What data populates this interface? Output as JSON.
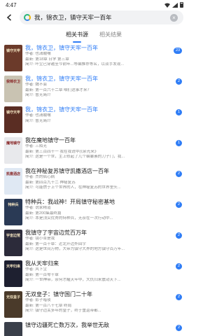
{
  "status": {
    "time": "4:47"
  },
  "search": {
    "query": "我，锦衣卫，镇守天牢一百年"
  },
  "tabs": [
    {
      "label": "相关书源"
    },
    {
      "label": "相关结果"
    }
  ],
  "books": [
    {
      "title": "我，锦衣卫，镇守天牢一百年",
      "author": "作者: 也潇酸嘴",
      "latest": "最新: 第18章 日学 第三章 ",
      "intro": "简介: 叶尘已穿越至今前年...等编推荐等名，以双手发现...",
      "source_count": "23",
      "highlight": true,
      "cover_color": "#6b3a2a",
      "cover_text": "镇守天牢"
    },
    {
      "title": "我，锦衣卫，镇守天牢一百年",
      "author": "作者: 魏不会",
      "latest": "最新: 第一百六十二章 咱们这事才来？",
      "intro": "简介: 暂无简介",
      "source_count": "2",
      "highlight": true,
      "cover_color": "#c9c3b2",
      "cover_text": "我锦衣卫"
    },
    {
      "title": "我，锦衣卫，镇守天牢一百年",
      "author": "作者: 也潇酸嘴",
      "latest": "",
      "intro": "简介: 暂无简介",
      "source_count": "1",
      "highlight": true,
      "cover_color": "#5a2d23",
      "cover_text": "镇守天牢"
    },
    {
      "title": "我在魔地镇守一百年",
      "author": "作者: 三陌无",
      "latest": "最新: 第三百四十一 我在我说中(《余光来》",
      "intro": "简介: 这是一个世，主上修起了几个编纂素的刀子门，我...",
      "source_count": "1",
      "highlight": false,
      "cover_color": "#e8e9ec",
      "cover_text": "魔地镇守"
    },
    {
      "title": "我在神秘复苏镇守凯撒酒店一百年",
      "author": "作者: 杰的疯心病",
      "latest": "最新: 第四百九十二 神秘复苏",
      "intro": "简介: 可能惯于上个世界的人，在神秘复苏的世界里头...",
      "source_count": "2",
      "highlight": false,
      "cover_color": "#dfe8f3",
      "cover_text": "凯撒酒店"
    },
    {
      "title": "特种兵：我战神！开局镇守秘密基地",
      "author": "作者: 说家精道",
      "latest": "最新: 第200集最终篇",
      "intro": "简介: 本是顶尖优秀的特种兵，无奈在一次行动中...",
      "source_count": "2",
      "highlight": false,
      "cover_color": "#2a3a55",
      "cover_text": "特种兵"
    },
    {
      "title": "我镇守了宇宙边荒百万年",
      "author": "作者: 镜小草是我",
      "latest": "最新: 第一百十章：近北开边外回宇",
      "intro": "简介: 这是世间万物，大帝为镇守大界的地方镇守百万年...",
      "source_count": "2",
      "highlight": false,
      "cover_color": "#2c2b3a",
      "cover_text": "宇宙边荒"
    },
    {
      "title": "我从天牢归来",
      "author": "作者: 风下尘",
      "latest": "最新: 第一百零十章",
      "intro": "简介: 一世神帝，奈何才醒天牢中，大仇归来震动天下...",
      "source_count": "2",
      "highlight": false,
      "cover_color": "#1e2030",
      "cover_text": "天牢归来"
    },
    {
      "title": "无双皇子：镇守国门二十年",
      "author": "作者: 影子暗夜",
      "latest": "最新: 第一百八十七章 终局",
      "intro": "简介: 镇守边关多年的皇子，终于重返帝都...",
      "source_count": "2",
      "highlight": false,
      "cover_color": "#4a3a2a",
      "cover_text": "无双皇子"
    },
    {
      "title": "镇守边疆死亡数万次，我举世无敌",
      "author": "",
      "latest": "",
      "intro": "",
      "source_count": "2",
      "highlight": false,
      "cover_color": "#3a3f4a",
      "cover_text": ""
    }
  ]
}
